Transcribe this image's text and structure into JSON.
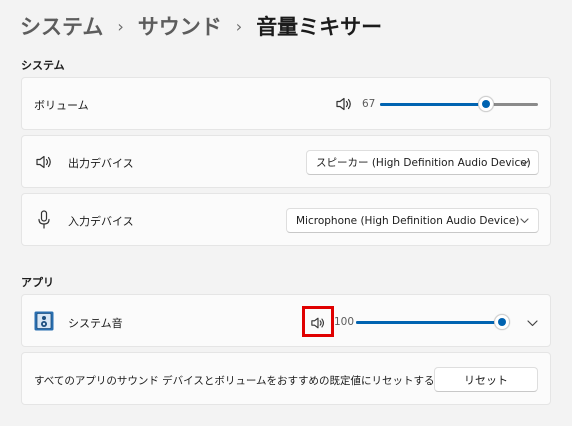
{
  "breadcrumb": {
    "items": [
      "システム",
      "サウンド",
      "音量ミキサー"
    ],
    "separator": "›"
  },
  "system_section": {
    "label": "システム",
    "volume": {
      "label": "ボリューム",
      "value": "67",
      "level_percent": 67,
      "icon": "speaker-icon"
    },
    "output_device": {
      "label": "出力デバイス",
      "icon": "speaker-icon",
      "selected": "スピーカー (High Definition Audio Device)"
    },
    "input_device": {
      "label": "入力デバイス",
      "icon": "microphone-icon",
      "selected": "Microphone (High Definition Audio Device)"
    }
  },
  "apps_section": {
    "label": "アプリ",
    "apps": [
      {
        "name": "システム音",
        "icon": "system-sounds-icon",
        "volume": "100",
        "level_percent": 100,
        "volume_icon": "speaker-icon"
      }
    ],
    "reset": {
      "text": "すべてのアプリのサウンド デバイスとボリュームをおすすめの既定値にリセットする",
      "button_label": "リセット"
    }
  },
  "colors": {
    "accent": "#0063b1",
    "background": "#f3f3f3",
    "card": "#fbfbfb",
    "highlight": "#e00000"
  }
}
